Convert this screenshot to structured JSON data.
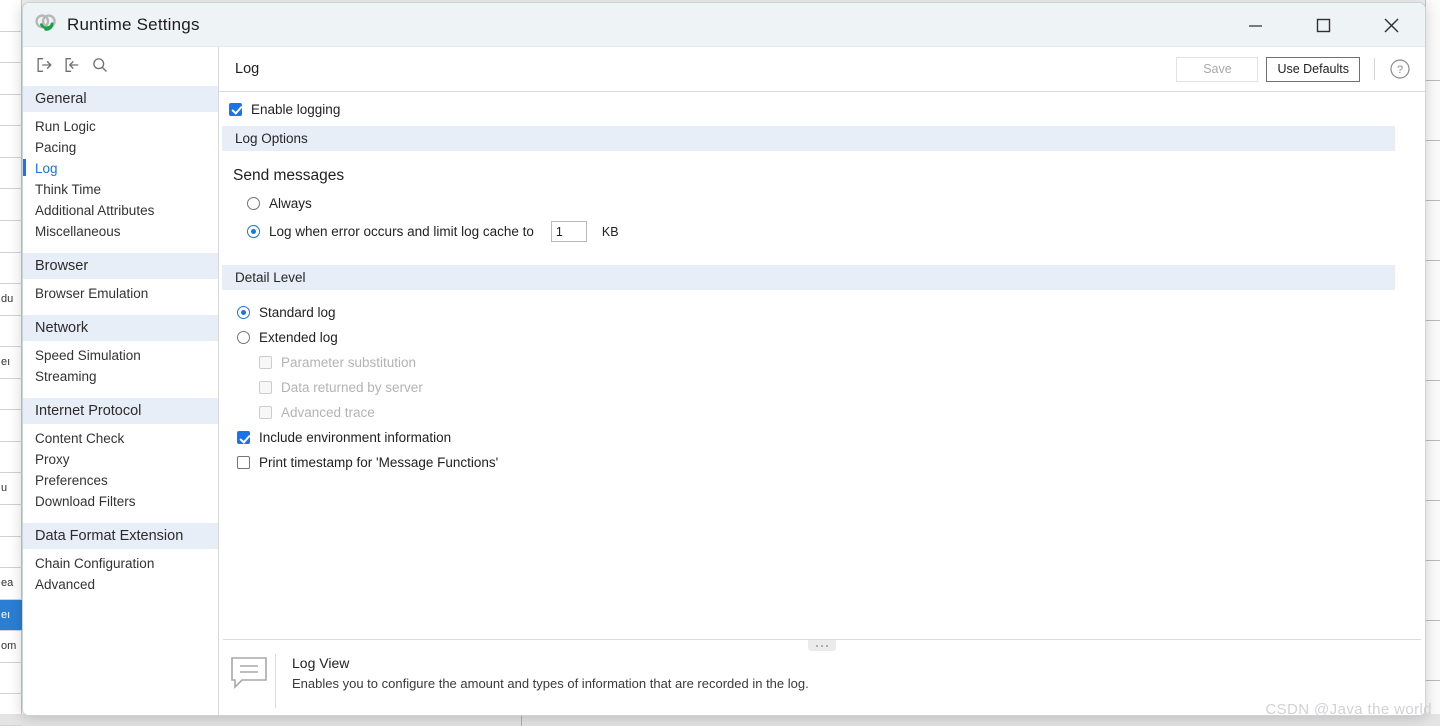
{
  "window": {
    "title": "Runtime Settings",
    "logo_icon": "loadrunner-logo-icon",
    "controls": {
      "minimize": "minimize-icon",
      "maximize": "maximize-icon",
      "close": "close-icon"
    }
  },
  "sidebar": {
    "toolbar": [
      {
        "icon": "expand-all-icon"
      },
      {
        "icon": "collapse-all-icon"
      },
      {
        "icon": "search-icon"
      }
    ],
    "groups": [
      {
        "label": "General",
        "items": [
          {
            "label": "Run Logic",
            "active": false
          },
          {
            "label": "Pacing",
            "active": false
          },
          {
            "label": "Log",
            "active": true
          },
          {
            "label": "Think Time",
            "active": false
          },
          {
            "label": "Additional Attributes",
            "active": false
          },
          {
            "label": "Miscellaneous",
            "active": false
          }
        ]
      },
      {
        "label": "Browser",
        "items": [
          {
            "label": "Browser Emulation",
            "active": false
          }
        ]
      },
      {
        "label": "Network",
        "items": [
          {
            "label": "Speed Simulation",
            "active": false
          },
          {
            "label": "Streaming",
            "active": false
          }
        ]
      },
      {
        "label": "Internet Protocol",
        "items": [
          {
            "label": "Content Check",
            "active": false
          },
          {
            "label": "Proxy",
            "active": false
          },
          {
            "label": "Preferences",
            "active": false
          },
          {
            "label": "Download Filters",
            "active": false
          }
        ]
      },
      {
        "label": "Data Format Extension",
        "items": [
          {
            "label": "Chain Configuration",
            "active": false
          },
          {
            "label": "Advanced",
            "active": false
          }
        ]
      }
    ]
  },
  "main": {
    "pane_title": "Log",
    "actions": {
      "save_label": "Save",
      "save_enabled": false,
      "use_defaults_label": "Use Defaults",
      "help_icon": "help-circle-icon"
    },
    "enable_logging": {
      "label": "Enable logging",
      "checked": true
    },
    "log_options": {
      "section_label": "Log Options",
      "group_label": "Send messages",
      "options": [
        {
          "label": "Always",
          "selected": false
        },
        {
          "label": "Log when error occurs and limit log cache to",
          "selected": true
        }
      ],
      "cache_value": "1",
      "cache_unit": "KB"
    },
    "detail_level": {
      "section_label": "Detail Level",
      "options": [
        {
          "label": "Standard log",
          "selected": true
        },
        {
          "label": "Extended log",
          "selected": false
        }
      ],
      "sub_options": [
        {
          "label": "Parameter substitution",
          "checked": false,
          "disabled": true
        },
        {
          "label": "Data returned by server",
          "checked": false,
          "disabled": true
        },
        {
          "label": "Advanced trace",
          "checked": false,
          "disabled": true
        }
      ],
      "extra_options": [
        {
          "label": "Include environment information",
          "checked": true,
          "disabled": false
        },
        {
          "label": "Print timestamp for 'Message Functions'",
          "checked": false,
          "disabled": false
        }
      ]
    },
    "help_panel": {
      "icon": "comment-lines-icon",
      "title": "Log View",
      "description": "Enables you to configure the amount and types of information that are recorded in the log."
    }
  },
  "watermark": {
    "text": "CSDN @Java the world"
  },
  "background": {
    "left_rows": [
      "",
      "",
      "",
      "",
      "",
      "",
      "",
      "",
      "",
      "du",
      "",
      "eı",
      "",
      "",
      "",
      "u",
      "",
      "",
      "ea",
      "eı",
      "om",
      "",
      ""
    ],
    "selected_row_index": 19,
    "top_glyph_text": "",
    "bottom_label": "",
    "bottom_hint": ""
  },
  "colors": {
    "accent": "#1a73e8",
    "section_bar": "#e8eef7",
    "titlebar": "#eef4f6",
    "logo_green": "#16a34a",
    "logo_gray": "#b8b8b8"
  }
}
